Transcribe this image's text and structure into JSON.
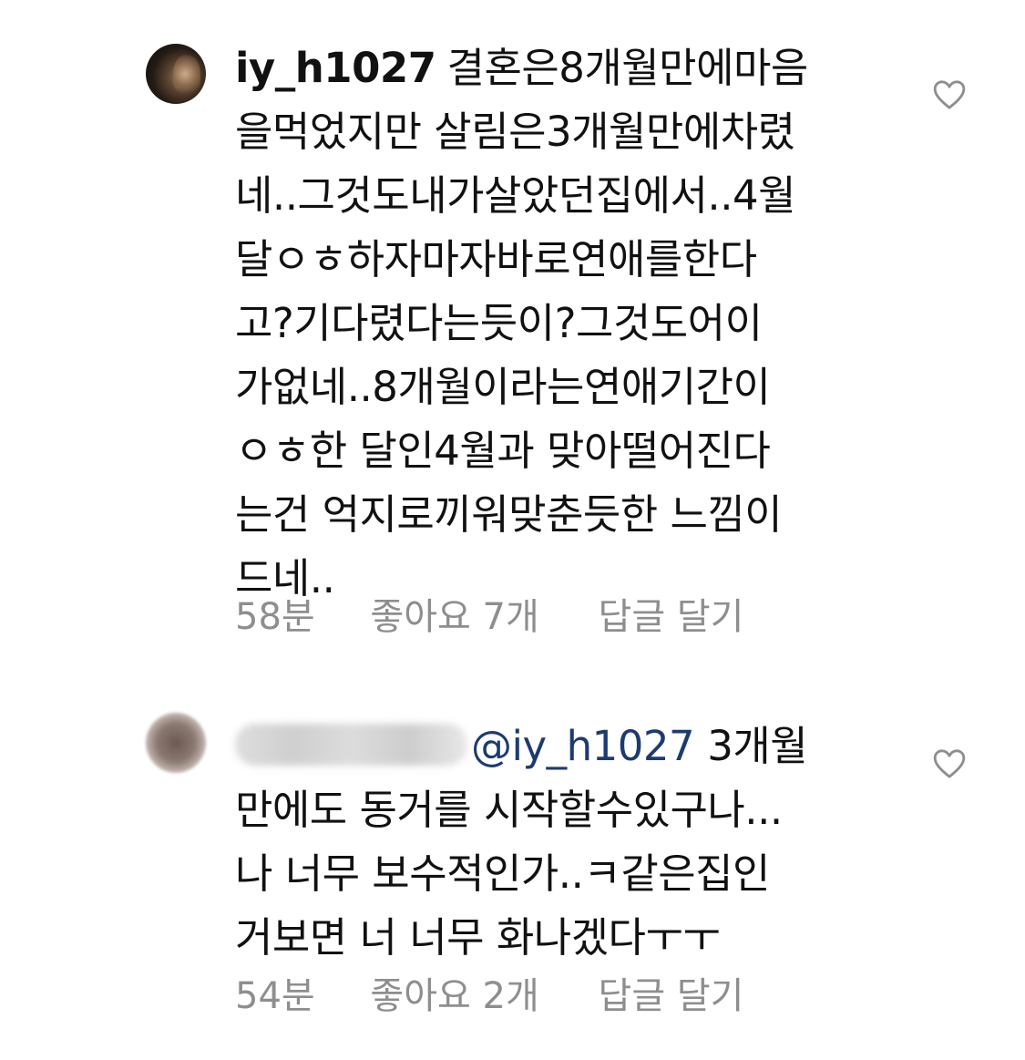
{
  "comments": [
    {
      "username": "iy_h1027",
      "lines": [
        "결혼은8개월만에마음",
        "을먹었지만 살림은3개월만에차렸",
        "네..그것도내가살았던집에서..4월",
        "달ㅇㅎ하자마자바로연애를한다",
        "고?기다렸다는듯이?그것도어이",
        "가없네..8개월이라는연애기간이",
        "ㅇㅎ한 달인4월과 맞아떨어진다",
        "는건 억지로끼워맞춘듯한 느낌이",
        "드네.."
      ],
      "time": "58분",
      "likes": "좋아요 7개",
      "reply": "답글 달기",
      "like_icon": "heart-outline-icon"
    },
    {
      "mention": "@iy_h1027",
      "lines": [
        "3개월",
        "만에도 동거를 시작할수있구나...",
        "나 너무 보수적인가..ㅋ같은집인",
        "거보면 너 너무 화나겠다ㅜㅜ"
      ],
      "time": "54분",
      "likes": "좋아요 2개",
      "reply": "답글 달기",
      "like_icon": "heart-outline-icon"
    }
  ],
  "colors": {
    "text": "#111111",
    "meta": "#8e8e8e",
    "mention": "#1d3b70"
  }
}
